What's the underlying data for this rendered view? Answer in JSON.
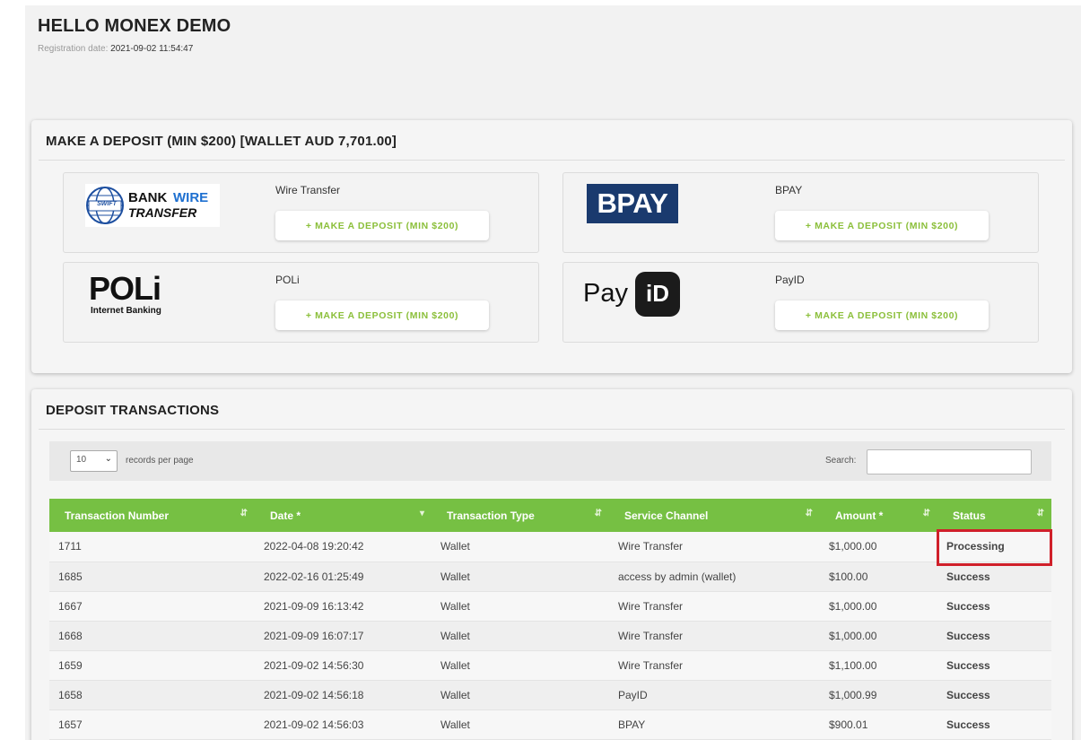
{
  "header": {
    "greeting": "HELLO MONEX DEMO",
    "registration_label": "Registration date:",
    "registration_value": "2021-09-02 11:54:47"
  },
  "deposit": {
    "title": "MAKE A DEPOSIT (MIN $200) [WALLET AUD 7,701.00]",
    "methods": [
      {
        "name": "Wire Transfer",
        "button": "+ MAKE A DEPOSIT (MIN $200)",
        "logo": "bank-wire-transfer-logo",
        "logo_text_1": "BANK",
        "logo_text_2": "WIRE",
        "logo_text_3": "TRANSFER",
        "logo_badge": "SWIFT"
      },
      {
        "name": "BPAY",
        "button": "+ MAKE A DEPOSIT (MIN $200)",
        "logo": "bpay-logo",
        "logo_text": "BPAY"
      },
      {
        "name": "POLi",
        "button": "+ MAKE A DEPOSIT (MIN $200)",
        "logo": "poli-logo",
        "logo_text": "POLi",
        "logo_sub": "Internet Banking"
      },
      {
        "name": "PayID",
        "button": "+ MAKE A DEPOSIT (MIN $200)",
        "logo": "payid-logo",
        "logo_text": "Pay",
        "logo_badge": "iD"
      }
    ]
  },
  "transactions": {
    "title": "DEPOSIT TRANSACTIONS",
    "records_per_page": "10",
    "records_label": "records per page",
    "search_label": "Search:",
    "search_value": "",
    "columns": [
      "Transaction Number",
      "Date *",
      "Transaction Type",
      "Service Channel",
      "Amount *",
      "Status"
    ],
    "rows": [
      {
        "number": "1711",
        "date": "2022-04-08 19:20:42",
        "type": "Wallet",
        "channel": "Wire Transfer",
        "amount": "$1,000.00",
        "status": "Processing"
      },
      {
        "number": "1685",
        "date": "2022-02-16 01:25:49",
        "type": "Wallet",
        "channel": "access by admin (wallet)",
        "amount": "$100.00",
        "status": "Success"
      },
      {
        "number": "1667",
        "date": "2021-09-09 16:13:42",
        "type": "Wallet",
        "channel": "Wire Transfer",
        "amount": "$1,000.00",
        "status": "Success"
      },
      {
        "number": "1668",
        "date": "2021-09-09 16:07:17",
        "type": "Wallet",
        "channel": "Wire Transfer",
        "amount": "$1,000.00",
        "status": "Success"
      },
      {
        "number": "1659",
        "date": "2021-09-02 14:56:30",
        "type": "Wallet",
        "channel": "Wire Transfer",
        "amount": "$1,100.00",
        "status": "Success"
      },
      {
        "number": "1658",
        "date": "2021-09-02 14:56:18",
        "type": "Wallet",
        "channel": "PayID",
        "amount": "$1,000.99",
        "status": "Success"
      },
      {
        "number": "1657",
        "date": "2021-09-02 14:56:03",
        "type": "Wallet",
        "channel": "BPAY",
        "amount": "$900.01",
        "status": "Success"
      }
    ]
  },
  "colors": {
    "accent_green": "#76c043",
    "success": "#8bbf3a",
    "processing": "#e0a82e",
    "highlight_box": "#d0202a",
    "bpay_blue": "#1a3a6e"
  }
}
